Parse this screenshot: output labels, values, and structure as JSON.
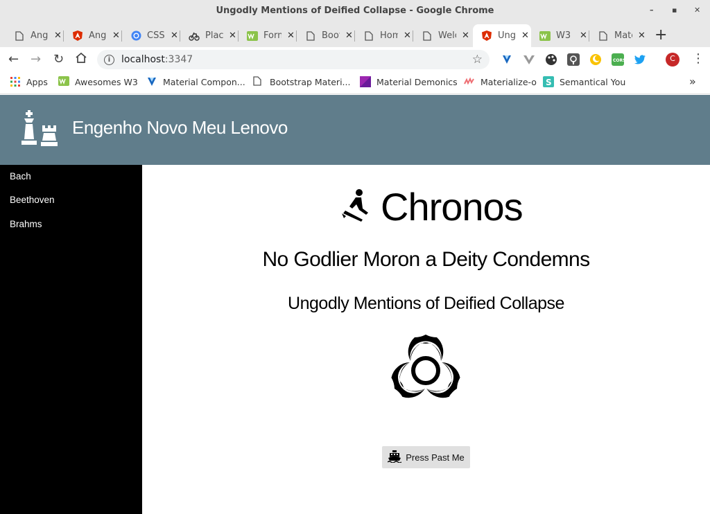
{
  "window": {
    "title": "Ungodly Mentions of Deified Collapse - Google Chrome"
  },
  "tabs": [
    {
      "label": "Angular",
      "icon": "document-icon"
    },
    {
      "label": "Angular",
      "icon": "angular-icon"
    },
    {
      "label": "CSS",
      "icon": "chromium-icon"
    },
    {
      "label": "Placeholder",
      "icon": "bicycle-icon"
    },
    {
      "label": "Form",
      "icon": "w3-icon"
    },
    {
      "label": "Bootstrap",
      "icon": "document-icon"
    },
    {
      "label": "Home",
      "icon": "document-icon"
    },
    {
      "label": "Welcome",
      "icon": "document-icon"
    },
    {
      "label": "Ungodly",
      "icon": "angular-icon",
      "active": true
    },
    {
      "label": "W3",
      "icon": "w3-icon"
    },
    {
      "label": "Material",
      "icon": "document-icon"
    }
  ],
  "address": {
    "host": "localhost",
    "port": ":3347"
  },
  "bookmarks": [
    {
      "label": "Apps",
      "icon": "apps-grid-icon"
    },
    {
      "label": "Awesomes W3",
      "icon": "w3-icon"
    },
    {
      "label": "Material Compon...",
      "icon": "vuetify-icon"
    },
    {
      "label": "Bootstrap Materi...",
      "icon": "document-icon"
    },
    {
      "label": "Material Demonics",
      "icon": "material-icon"
    },
    {
      "label": "Materialize-o",
      "icon": "materialize-icon"
    },
    {
      "label": "Semantical You",
      "icon": "semantic-icon"
    }
  ],
  "app": {
    "title": "Engenho Novo Meu Lenovo",
    "header_color": "#607d8b"
  },
  "sidebar": {
    "items": [
      {
        "label": "Bach"
      },
      {
        "label": "Beethoven"
      },
      {
        "label": "Brahms"
      }
    ]
  },
  "main": {
    "title": "Chronos",
    "subtitle": "No Godlier Moron a Deity Condemns",
    "tagline": "Ungodly Mentions of Deified Collapse",
    "button_label": "Press Past Me"
  }
}
